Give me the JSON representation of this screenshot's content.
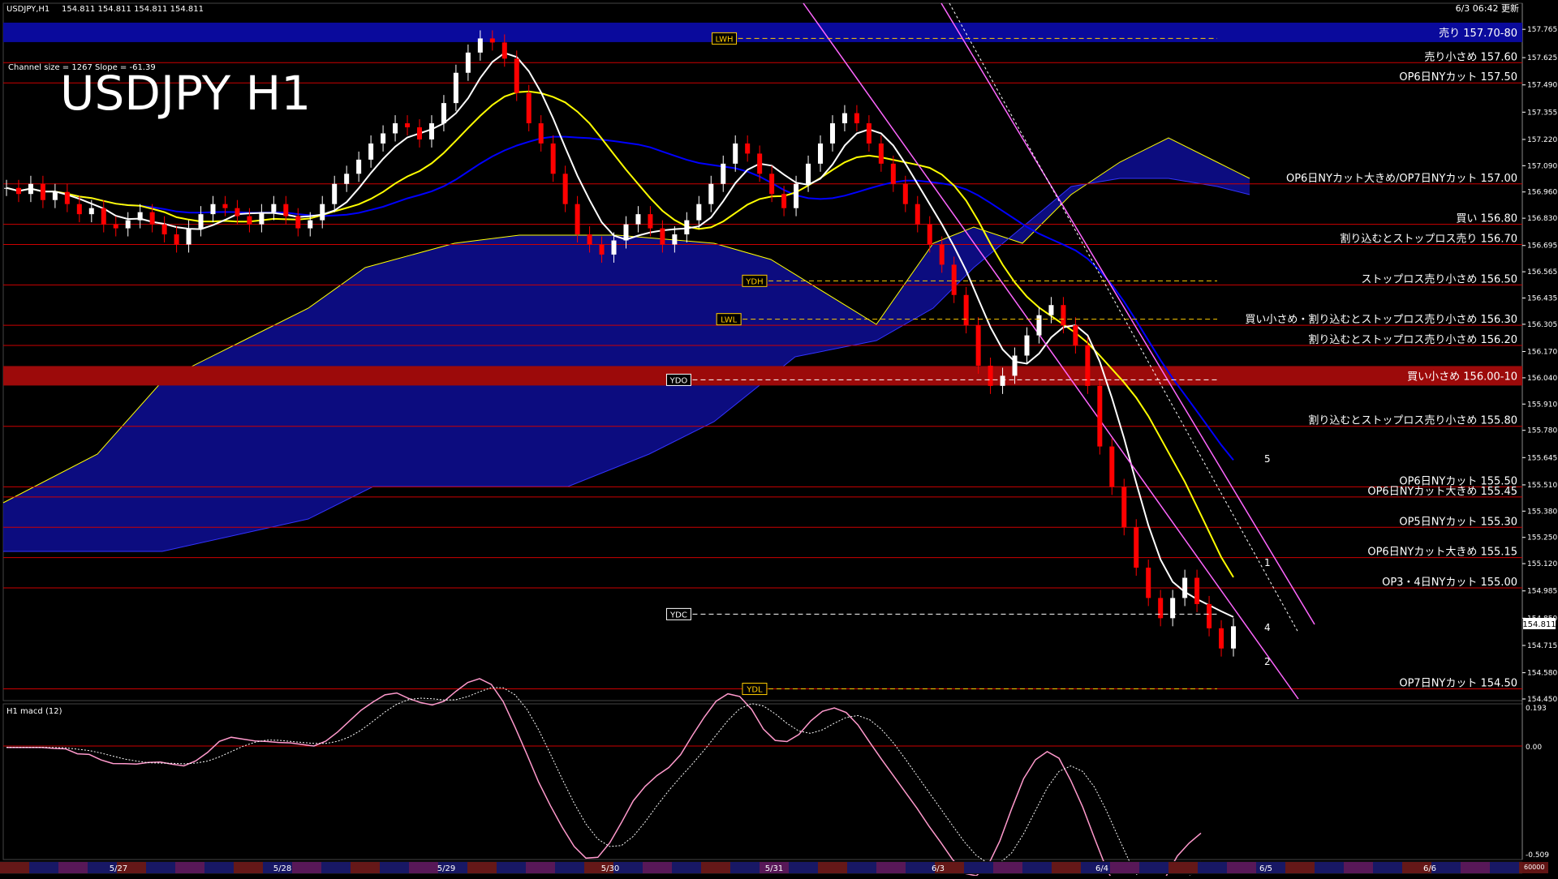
{
  "window": {
    "title": "USDJPY,H1",
    "ohlc": "154.811 154.811 154.811 154.811",
    "timestamp": "6/3 06:42 更新"
  },
  "main_panel": {
    "big_title": "USDJPY H1",
    "channel_info": "Channel size = 1267 Slope = -61.39",
    "current_price_tag": "154.811"
  },
  "macd_panel": {
    "label": "H1 macd (12)",
    "scale_top": "0.193",
    "scale_zero": "0.00",
    "scale_bottom": "-0.509",
    "scale_corner": "60000"
  },
  "colors": {
    "background": "#000000",
    "ichimoku_cloud": "#1010aa",
    "price_level_line": "#cc0000",
    "bull_candle": "#ffffff",
    "bear_candle": "#ff0000",
    "ma_white": "#ffffff",
    "ma_yellow": "#ffff00",
    "ma_blue": "#0000ff",
    "channel_line": "#ff66ff",
    "macd_line": "#ff99cc",
    "macd_signal": "#ffffff"
  },
  "price_axis_ticks": [
    "157.765",
    "157.625",
    "157.490",
    "157.355",
    "157.220",
    "157.090",
    "156.960",
    "156.830",
    "156.695",
    "156.565",
    "156.435",
    "156.305",
    "156.170",
    "156.040",
    "155.910",
    "155.780",
    "155.645",
    "155.510",
    "155.380",
    "155.250",
    "155.120",
    "154.985",
    "154.850",
    "154.715",
    "154.580",
    "154.450"
  ],
  "levels": [
    {
      "label": "売り 157.70-80",
      "price": 157.75,
      "band": true,
      "color": "#0a0a9c"
    },
    {
      "label": "売り小さめ 157.60",
      "price": 157.6
    },
    {
      "label": "OP6日NYカット 157.50",
      "price": 157.5
    },
    {
      "label": "OP6日NYカット大きめ/OP7日NYカット 157.00",
      "price": 157.0
    },
    {
      "label": "買い 156.80",
      "price": 156.8
    },
    {
      "label": "割り込むとストップロス売り 156.70",
      "price": 156.7
    },
    {
      "label": "ストップロス売り小さめ 156.50",
      "price": 156.5
    },
    {
      "label": "買い小さめ・割り込むとストップロス売り小さめ 156.30",
      "price": 156.3
    },
    {
      "label": "割り込むとストップロス売り小さめ 156.20",
      "price": 156.2
    },
    {
      "label": "買い小さめ 156.00-10",
      "price": 156.05,
      "band": true,
      "color": "#9c0a0a"
    },
    {
      "label": "割り込むとストップロス売り小さめ 155.80",
      "price": 155.8
    },
    {
      "label": "OP6日NYカット 155.50",
      "price": 155.5
    },
    {
      "label": "OP6日NYカット大きめ 155.45",
      "price": 155.45
    },
    {
      "label": "OP5日NYカット 155.30",
      "price": 155.3
    },
    {
      "label": "OP6日NYカット大きめ 155.15",
      "price": 155.15
    },
    {
      "label": "OP3・4日NYカット 155.00",
      "price": 155.0
    },
    {
      "label": "OP7日NYカット 154.50",
      "price": 154.5
    }
  ],
  "marker_tags": [
    {
      "text": "LWH",
      "price": 157.72,
      "xf": 0.465,
      "color": "#ffcc00"
    },
    {
      "text": "YDH",
      "price": 156.52,
      "xf": 0.485,
      "color": "#ffcc00"
    },
    {
      "text": "LWL",
      "price": 156.33,
      "xf": 0.468,
      "color": "#ffcc00"
    },
    {
      "text": "YDO",
      "price": 156.03,
      "xf": 0.435,
      "color": "#ffffff"
    },
    {
      "text": "YDC",
      "price": 154.87,
      "xf": 0.435,
      "color": "#ffffff"
    },
    {
      "text": "YDL",
      "price": 154.5,
      "xf": 0.485,
      "color": "#ffcc00"
    }
  ],
  "time_labels": [
    "5/27",
    "5/28",
    "5/29",
    "5/30",
    "5/31",
    "6/3",
    "6/4",
    "6/5",
    "6/6"
  ],
  "wave_labels": [
    "5",
    "1",
    "4",
    "2"
  ],
  "chart_data": {
    "type": "candlestick",
    "symbol": "USDJPY",
    "timeframe": "H1",
    "ylim": [
      154.45,
      157.83
    ],
    "close_series": [
      156.98,
      156.95,
      157.0,
      156.92,
      156.96,
      156.9,
      156.85,
      156.88,
      156.8,
      156.78,
      156.82,
      156.86,
      156.8,
      156.75,
      156.7,
      156.78,
      156.85,
      156.9,
      156.88,
      156.84,
      156.8,
      156.86,
      156.9,
      156.84,
      156.78,
      156.82,
      156.9,
      157.0,
      157.05,
      157.12,
      157.2,
      157.25,
      157.3,
      157.28,
      157.22,
      157.3,
      157.4,
      157.55,
      157.65,
      157.72,
      157.7,
      157.62,
      157.45,
      157.3,
      157.2,
      157.05,
      156.9,
      156.75,
      156.7,
      156.65,
      156.72,
      156.8,
      156.85,
      156.78,
      156.7,
      156.75,
      156.82,
      156.9,
      157.0,
      157.1,
      157.2,
      157.15,
      157.05,
      156.95,
      156.88,
      157.0,
      157.1,
      157.2,
      157.3,
      157.35,
      157.3,
      157.2,
      157.1,
      157.0,
      156.9,
      156.8,
      156.7,
      156.6,
      156.45,
      156.3,
      156.1,
      156.0,
      156.05,
      156.15,
      156.25,
      156.35,
      156.4,
      156.3,
      156.2,
      156.0,
      155.7,
      155.5,
      155.3,
      155.1,
      154.95,
      154.85,
      154.95,
      155.05,
      154.92,
      154.8,
      154.7,
      154.81
    ]
  }
}
